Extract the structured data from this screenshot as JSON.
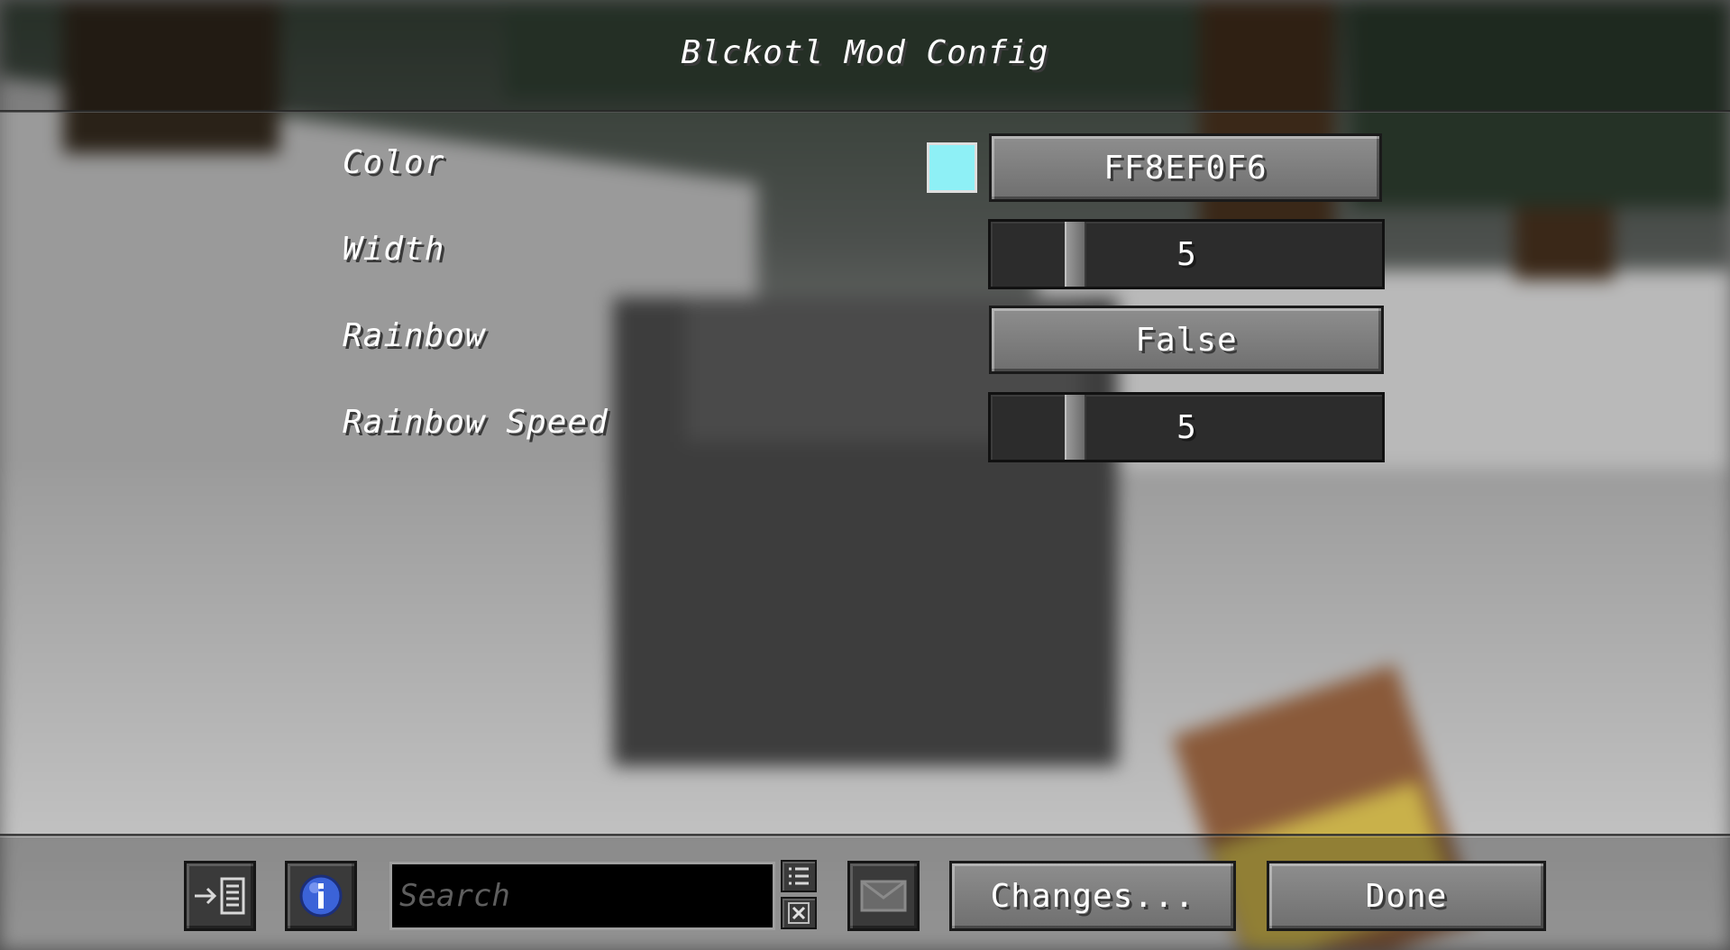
{
  "screen": {
    "title": "Blckotl Mod Config"
  },
  "options": [
    {
      "label": "Color",
      "value": "FF8EF0F6",
      "swatch_color": "#8EF0F6",
      "control": "button"
    },
    {
      "label": "Width",
      "value": "5",
      "control": "slider",
      "slider_fraction": 0.2
    },
    {
      "label": "Rainbow",
      "value": "False",
      "control": "button"
    },
    {
      "label": "Rainbow Speed",
      "value": "5",
      "control": "slider",
      "slider_fraction": 0.2
    }
  ],
  "footer": {
    "search_placeholder": "Search",
    "changes_label": "Changes...",
    "done_label": "Done",
    "icons": {
      "exit_list": "arrow-to-list-icon",
      "info": "info-icon",
      "filter_list": "list-icon",
      "clear": "clear-x-icon",
      "message": "envelope-icon"
    }
  },
  "colors": {
    "accent_swatch": "#8EF0F6",
    "info_blue": "#3b63d8"
  }
}
